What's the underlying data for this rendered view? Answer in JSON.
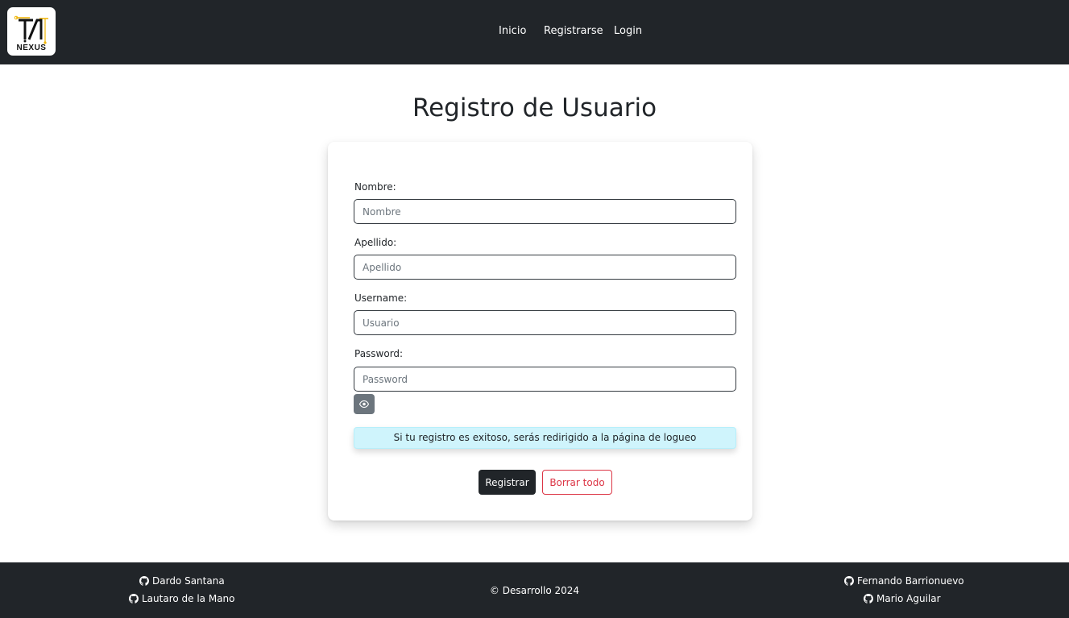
{
  "header": {
    "logo_text": "NEXUS",
    "nav": [
      "Inicio",
      "Registrarse",
      "Login"
    ]
  },
  "page_title": "Registro de Usuario",
  "form": {
    "fields": [
      {
        "label": "Nombre:",
        "placeholder": "Nombre",
        "value": ""
      },
      {
        "label": "Apellido:",
        "placeholder": "Apellido",
        "value": ""
      },
      {
        "label": "Username:",
        "placeholder": "Usuario",
        "value": ""
      },
      {
        "label": "Password:",
        "placeholder": "Password",
        "value": ""
      }
    ],
    "toggle_password_icon": "eye-icon",
    "info_message": "Si tu registro es exitoso, serás redirigido a la página de logueo",
    "submit_label": "Registrar",
    "clear_label": "Borrar todo"
  },
  "footer": {
    "left_credits": [
      "Dardo Santana",
      "Lautaro de la Mano"
    ],
    "right_credits": [
      "Fernando Barrionuevo",
      "Mario Aguilar"
    ],
    "credit_icon": "github-icon",
    "copyright": "© Desarrollo 2024"
  },
  "colors": {
    "navbar": "#212529",
    "alert_bg": "#cff4fc",
    "danger": "#dc3545",
    "secondary": "#6c757d",
    "logo_accent": "#f0b400"
  }
}
